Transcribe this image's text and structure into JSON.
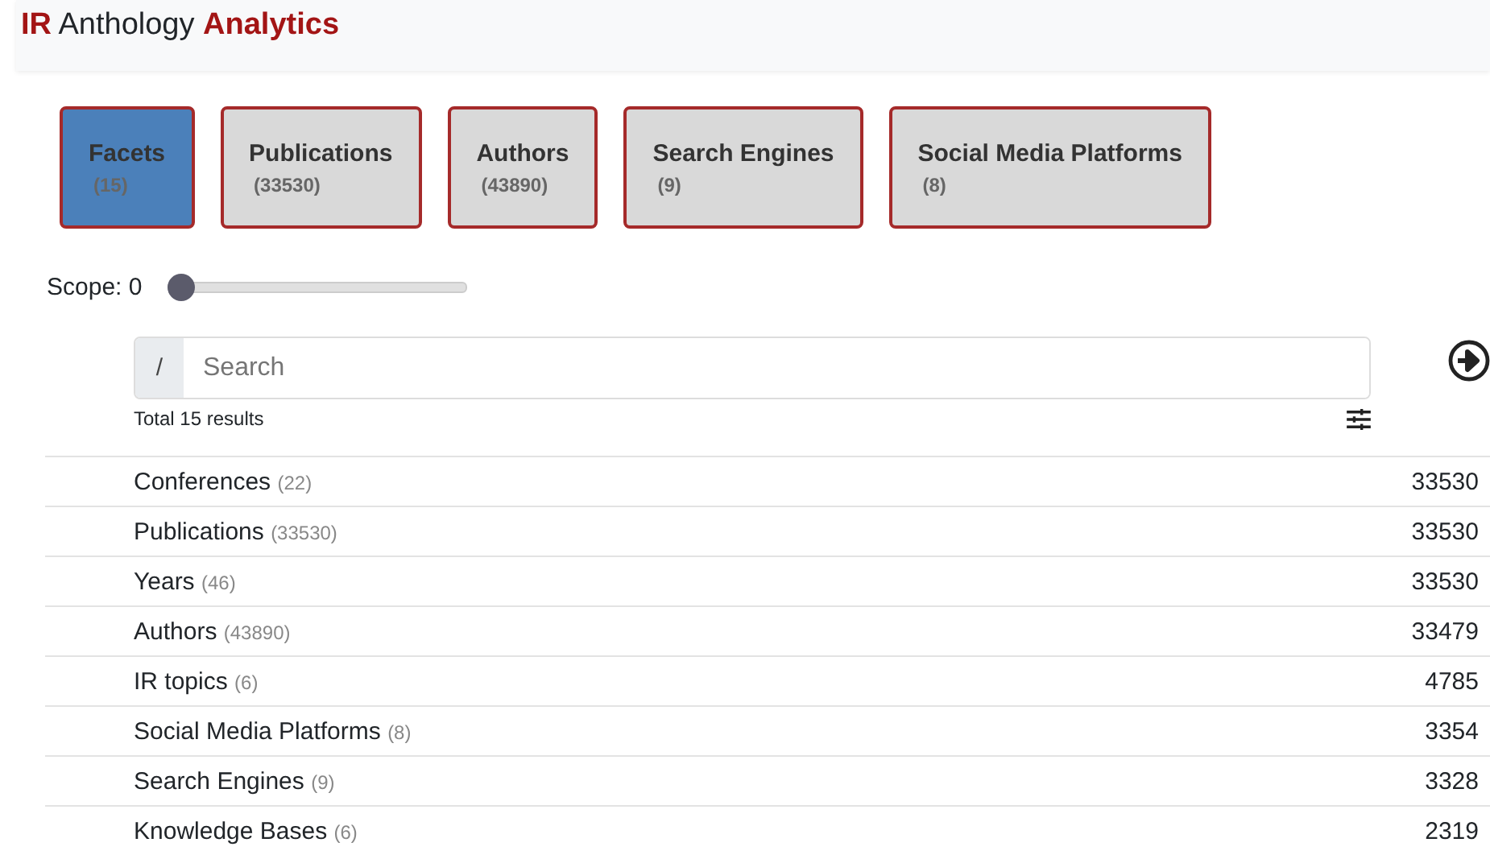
{
  "header": {
    "title": "**IR** Anthology **Analytics**"
  },
  "tabs": [
    {
      "label": "Facets",
      "count": "(15)",
      "selected": true
    },
    {
      "label": "Publications",
      "count": "(33530)",
      "selected": false
    },
    {
      "label": "Authors",
      "count": "(43890)",
      "selected": false
    },
    {
      "label": "Search Engines",
      "count": "(9)",
      "selected": false
    },
    {
      "label": "Social Media Platforms",
      "count": "(8)",
      "selected": false
    }
  ],
  "scope": {
    "label": "Scope: 0",
    "level": 0
  },
  "search": {
    "prefix": "/",
    "placeholder": "Search"
  },
  "total": "Total 15 results",
  "rows": [
    {
      "name": "Conferences",
      "count": "(22)",
      "value": "33530"
    },
    {
      "name": "Publications",
      "count": "(33530)",
      "value": "33530"
    },
    {
      "name": "Years",
      "count": "(46)",
      "value": "33530"
    },
    {
      "name": "Authors",
      "count": "(43890)",
      "value": "33479"
    },
    {
      "name": "IR topics",
      "count": "(6)",
      "value": "4785"
    },
    {
      "name": "Social Media Platforms",
      "count": "(8)",
      "value": "3354"
    },
    {
      "name": "Search Engines",
      "count": "(9)",
      "value": "3328"
    },
    {
      "name": "Knowledge Bases",
      "count": "(6)",
      "value": "2319"
    }
  ]
}
